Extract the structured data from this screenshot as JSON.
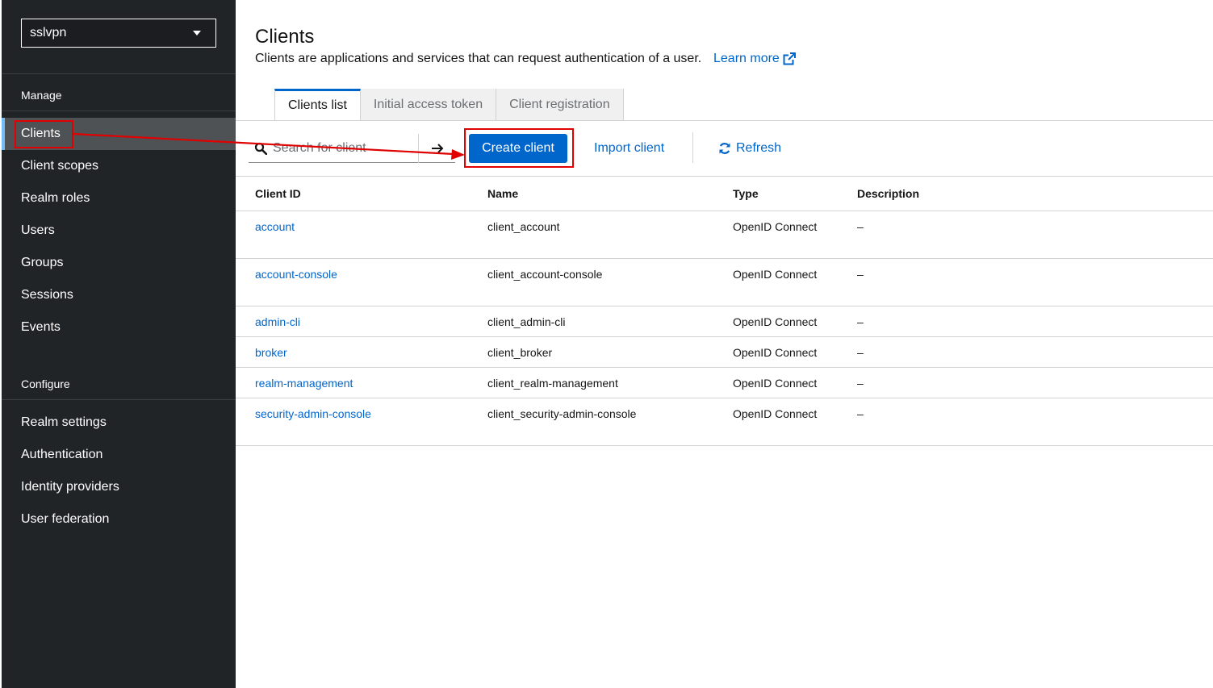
{
  "sidebar": {
    "realm_selector": "sslvpn",
    "manage_title": "Manage",
    "configure_title": "Configure",
    "manage_items": [
      "Clients",
      "Client scopes",
      "Realm roles",
      "Users",
      "Groups",
      "Sessions",
      "Events"
    ],
    "configure_items": [
      "Realm settings",
      "Authentication",
      "Identity providers",
      "User federation"
    ],
    "active_item": "Clients"
  },
  "header": {
    "title": "Clients",
    "description": "Clients are applications and services that can request authentication of a user.",
    "learn_more": "Learn more"
  },
  "tabs": [
    "Clients list",
    "Initial access token",
    "Client registration"
  ],
  "toolbar": {
    "search_placeholder": "Search for client",
    "create_label": "Create client",
    "import_label": "Import client",
    "refresh_label": "Refresh"
  },
  "table": {
    "columns": [
      "Client ID",
      "Name",
      "Type",
      "Description"
    ],
    "rows": [
      {
        "client_id": "account",
        "name": "client_account",
        "type": "OpenID Connect",
        "description": "–"
      },
      {
        "client_id": "account-console",
        "name": "client_account-console",
        "type": "OpenID Connect",
        "description": "–"
      },
      {
        "client_id": "admin-cli",
        "name": "client_admin-cli",
        "type": "OpenID Connect",
        "description": "–"
      },
      {
        "client_id": "broker",
        "name": "client_broker",
        "type": "OpenID Connect",
        "description": "–"
      },
      {
        "client_id": "realm-management",
        "name": "client_realm-management",
        "type": "OpenID Connect",
        "description": "–"
      },
      {
        "client_id": "security-admin-console",
        "name": "client_security-admin-console",
        "type": "OpenID Connect",
        "description": "–"
      }
    ]
  },
  "colors": {
    "sidebar_bg": "#212427",
    "link_blue": "#0066cc",
    "annotation_red": "#e00000",
    "active_accent": "#73bcf7"
  }
}
